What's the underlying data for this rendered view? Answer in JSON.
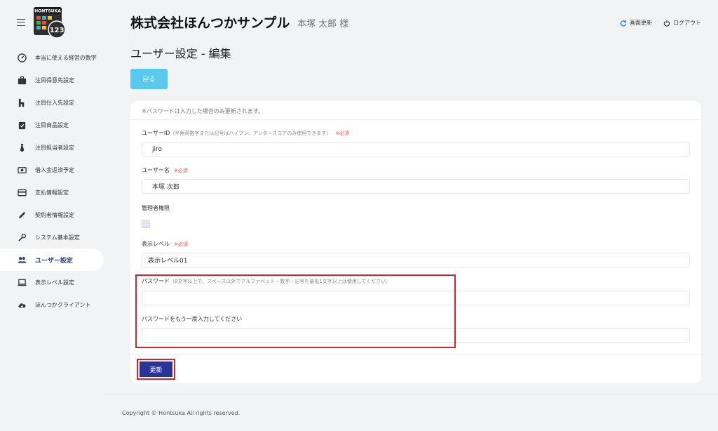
{
  "header": {
    "company": "株式会社ほんつかサンプル",
    "user": "本塚 太郎 様",
    "refresh_label": "画面更新",
    "logout_label": "ログアウト"
  },
  "logo": {
    "text": "HONTSUKA"
  },
  "sidebar": {
    "items": [
      {
        "label": "本当に使える経営の数字",
        "icon": "dashboard-gauge-icon"
      },
      {
        "label": "注目得意先設定",
        "icon": "briefcase-icon"
      },
      {
        "label": "注目仕入先設定",
        "icon": "h-logo-icon"
      },
      {
        "label": "注目商品設定",
        "icon": "clipboard-check-icon"
      },
      {
        "label": "注目担当者設定",
        "icon": "tie-icon"
      },
      {
        "label": "借入金返済予定",
        "icon": "money-icon"
      },
      {
        "label": "支払情報設定",
        "icon": "credit-card-icon"
      },
      {
        "label": "契約者情報設定",
        "icon": "pen-icon"
      },
      {
        "label": "システム基本設定",
        "icon": "wrench-icon"
      },
      {
        "label": "ユーザー設定",
        "icon": "users-icon"
      },
      {
        "label": "表示レベル設定",
        "icon": "laptop-icon"
      },
      {
        "label": "ほんつかクライアント",
        "icon": "cloud-download-icon"
      }
    ]
  },
  "main": {
    "title": "ユーザー設定 - 編集",
    "back_label": "戻る",
    "note": "※パスワードは入力した場合のみ更新されます。",
    "fields": {
      "user_id": {
        "label": "ユーザーID",
        "hint": "（半角英数字または記号はハイフン、アンダースコアのみ使用できます）",
        "required": "※必須",
        "value": "jiro"
      },
      "user_name": {
        "label": "ユーザー名",
        "required": "※必須",
        "value": "本塚 次郎"
      },
      "admin": {
        "label": "管理者権限"
      },
      "display_level": {
        "label": "表示レベル",
        "required": "※必須",
        "value": "表示レベル01"
      },
      "password": {
        "label": "パスワード",
        "hint": "（8文字以上で、スペース以外でアルファベット・数字・記号を最低1文字以上は使用してください）",
        "value": ""
      },
      "password_confirm": {
        "label": "パスワードをもう一度入力してください",
        "value": ""
      }
    },
    "update_label": "更新"
  },
  "footer": {
    "text": "Copyright © Hontsuka All rights reserved."
  },
  "colors": {
    "accent": "#2a3398",
    "back_button": "#5bc8ee",
    "required": "#e15a5a",
    "highlight": "#d6202a",
    "background": "#f2f3f5"
  }
}
